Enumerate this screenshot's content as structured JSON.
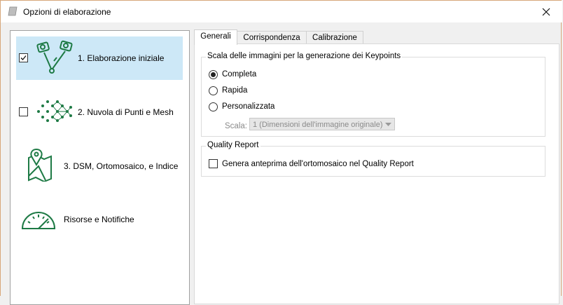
{
  "window": {
    "title": "Opzioni di elaborazione"
  },
  "sidebar": {
    "steps": [
      {
        "label": "1. Elaborazione iniziale",
        "checked": true,
        "selected": true,
        "icon": "drone-cameras-icon"
      },
      {
        "label": "2. Nuvola di Punti e Mesh",
        "checked": false,
        "selected": false,
        "icon": "point-cloud-icon"
      },
      {
        "label": "3. DSM, Ortomosaico, e Indice",
        "checked": false,
        "selected": false,
        "icon": "map-pin-icon"
      },
      {
        "label": "Risorse e Notifiche",
        "checked": null,
        "selected": false,
        "icon": "gauge-icon"
      }
    ]
  },
  "tabs": [
    {
      "label": "Generali",
      "active": true
    },
    {
      "label": "Corrispondenza",
      "active": false
    },
    {
      "label": "Calibrazione",
      "active": false
    }
  ],
  "keypoints_group": {
    "title": "Scala delle immagini per la generazione dei Keypoints",
    "options": [
      {
        "label": "Completa",
        "selected": true
      },
      {
        "label": "Rapida",
        "selected": false
      },
      {
        "label": "Personalizzata",
        "selected": false
      }
    ],
    "scale_label": "Scala:",
    "scale_value": "1 (Dimensioni dell'immagine originale)"
  },
  "quality_group": {
    "title": "Quality Report",
    "checkbox_label": "Genera anteprima dell'ortomosaico nel Quality Report",
    "checked": false
  },
  "colors": {
    "accent_green": "#1e7a45",
    "selection": "#cde8f7"
  }
}
